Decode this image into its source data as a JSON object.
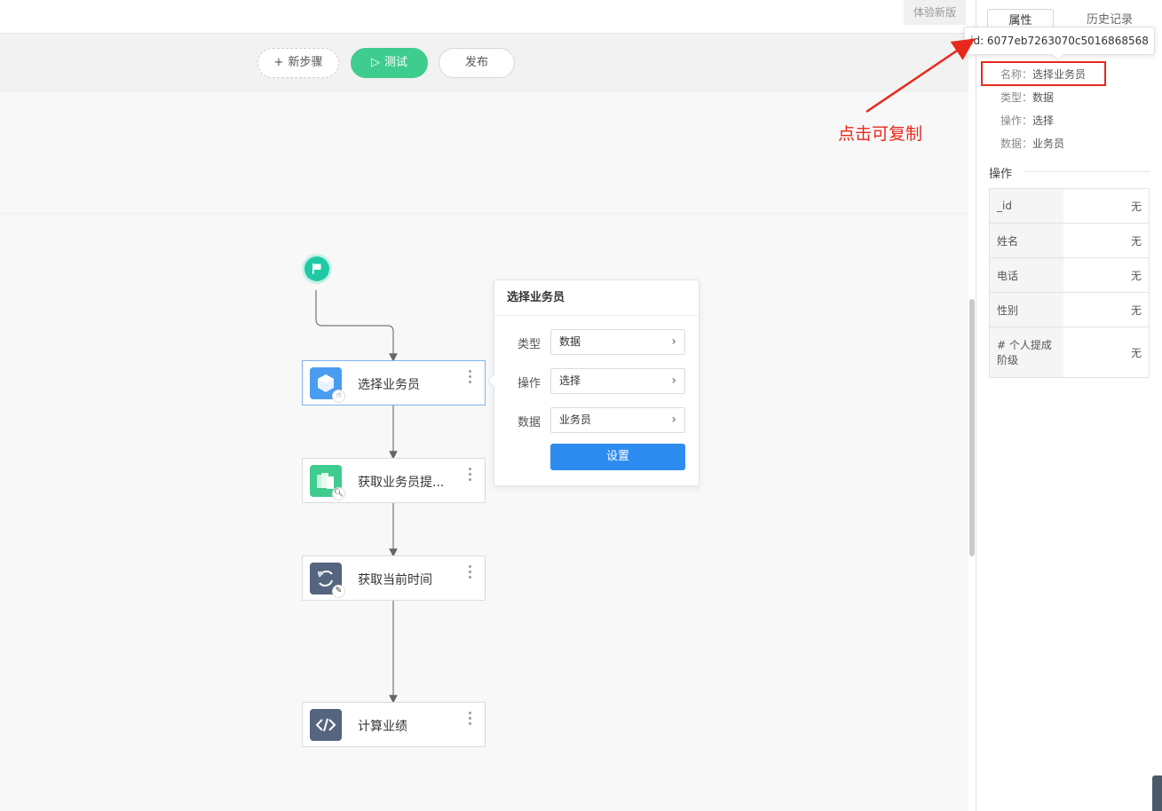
{
  "topbar": {
    "new_version_label": "体验新版"
  },
  "toolbar": {
    "new_step_glyph": "+",
    "new_step_label": "新步骤",
    "test_glyph": "▷",
    "test_label": "测试",
    "publish_label": "发布"
  },
  "workflow": {
    "start_icon": "flag-icon",
    "nodes": [
      {
        "label": "选择业务员",
        "icon": "data-select-icon",
        "badge": "pointer-icon",
        "color": "#4a9cf0",
        "selected": true
      },
      {
        "label": "获取业务员提...",
        "icon": "data-query-icon",
        "badge": "search-icon",
        "color": "#3fcc8f",
        "selected": false
      },
      {
        "label": "获取当前时间",
        "icon": "transform-icon",
        "badge": "edit-icon",
        "color": "#56657f",
        "selected": false
      },
      {
        "label": "计算业绩",
        "icon": "code-icon",
        "badge": "",
        "color": "#56657f",
        "selected": false
      }
    ]
  },
  "popover": {
    "title": "选择业务员",
    "rows": [
      {
        "label": "类型",
        "value": "数据"
      },
      {
        "label": "操作",
        "value": "选择"
      },
      {
        "label": "数据",
        "value": "业务员"
      }
    ],
    "chevron": "›",
    "set_button": "设置"
  },
  "tooltip": {
    "text": "id: 6077eb7263070c5016868568"
  },
  "annotation": {
    "text": "点击可复制",
    "color": "#e8281d"
  },
  "sidebar": {
    "tabs": [
      {
        "label": "属性",
        "active": true
      },
      {
        "label": "历史记录",
        "active": false
      }
    ],
    "props": [
      {
        "key": "名称：",
        "value": "选择业务员"
      },
      {
        "key": "类型：",
        "value": "数据"
      },
      {
        "key": "操作：",
        "value": "选择"
      },
      {
        "key": "数据：",
        "value": "业务员"
      }
    ],
    "section_title": "操作",
    "fields": [
      {
        "name": "_id",
        "value": "无"
      },
      {
        "name": "姓名",
        "value": "无"
      },
      {
        "name": "电话",
        "value": "无"
      },
      {
        "name": "性别",
        "value": "无"
      },
      {
        "name": "# 个人提成阶级",
        "value": "无"
      }
    ]
  },
  "colors": {
    "accent_green": "#3fcc8f",
    "accent_blue": "#2d8cf0",
    "start_teal": "#20c9a6"
  }
}
